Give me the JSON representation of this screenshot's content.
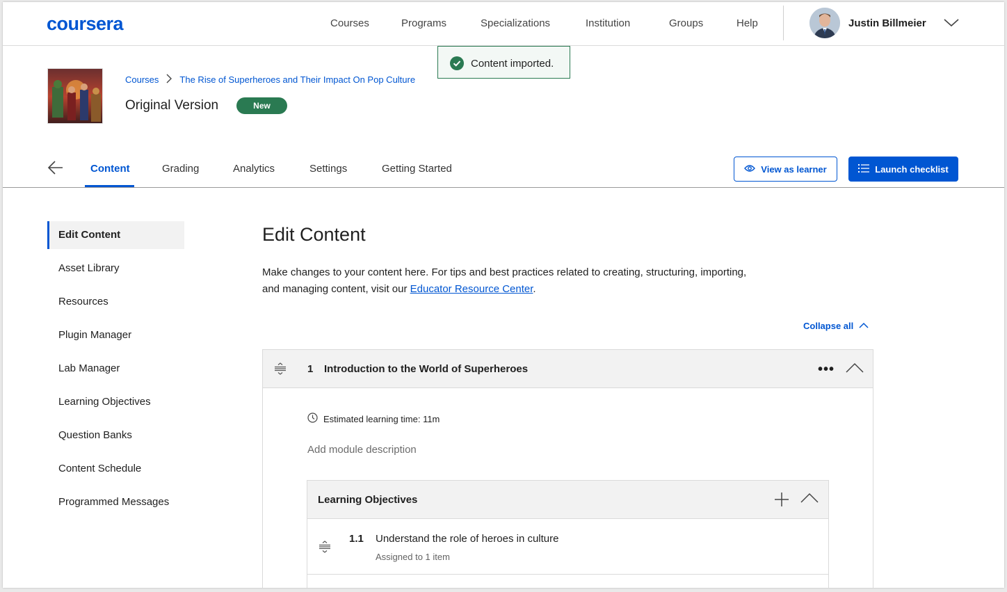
{
  "brand": {
    "logo": "coursera",
    "accent": "#0056d2",
    "success": "#2a7a52"
  },
  "topnav": {
    "links": [
      "Courses",
      "Programs",
      "Specializations",
      "Institution",
      "Groups",
      "Help"
    ],
    "user_name": "Justin Billmeier"
  },
  "toast": {
    "text": "Content imported.",
    "icon": "check-circle-icon"
  },
  "course": {
    "breadcrumb": [
      "Courses",
      "The Rise of Superheroes and Their Impact On Pop Culture"
    ],
    "version_title": "Original Version",
    "badge": "New"
  },
  "tabs": {
    "items": [
      "Content",
      "Grading",
      "Analytics",
      "Settings",
      "Getting Started"
    ],
    "active": "Content",
    "view_as_learner": "View as learner",
    "launch_checklist": "Launch checklist"
  },
  "sidebar": {
    "items": [
      "Edit Content",
      "Asset Library",
      "Resources",
      "Plugin Manager",
      "Lab Manager",
      "Learning Objectives",
      "Question Banks",
      "Content Schedule",
      "Programmed Messages"
    ],
    "active": "Edit Content"
  },
  "main": {
    "title": "Edit Content",
    "intro_text": "Make changes to your content here. For tips and best practices related to creating, structuring, importing, and managing content, visit our ",
    "intro_link": "Educator Resource Center",
    "intro_end": ".",
    "collapse_all": "Collapse all"
  },
  "module": {
    "number": "1",
    "title": "Introduction to the World of Superheroes",
    "estimated_time": "Estimated learning time: 11m",
    "description_placeholder": "Add module description",
    "learning_objectives": {
      "header": "Learning Objectives",
      "items": [
        {
          "number": "1.1",
          "text": "Understand the role of heroes in culture",
          "assigned": "Assigned to 1 item"
        }
      ]
    }
  }
}
